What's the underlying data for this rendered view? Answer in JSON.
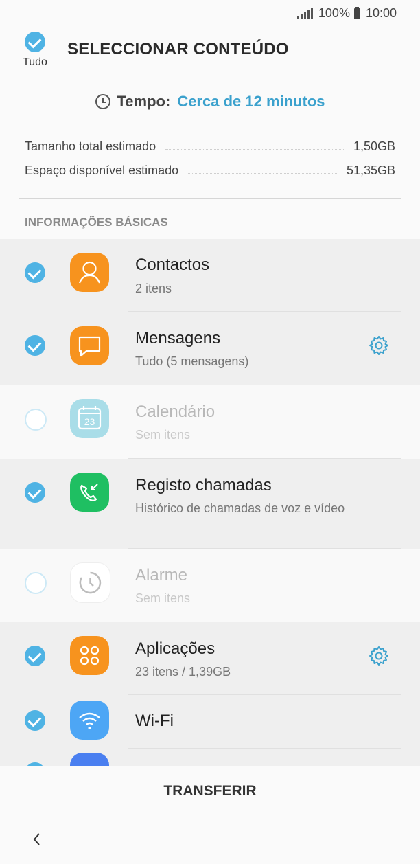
{
  "status": {
    "battery": "100%",
    "time": "10:00"
  },
  "header": {
    "select_all_label": "Tudo",
    "title": "SELECCIONAR CONTEÚDO"
  },
  "estimate": {
    "time_label": "Tempo:",
    "time_value": "Cerca de 12 minutos",
    "total_label": "Tamanho total estimado",
    "total_value": "1,50GB",
    "space_label": "Espaço disponível estimado",
    "space_value": "51,35GB"
  },
  "section": {
    "title": "INFORMAÇÕES BÁSICAS"
  },
  "items": [
    {
      "title": "Contactos",
      "subtitle": "2 itens",
      "checked": true,
      "icon": "contacts-icon",
      "color": "#f7931e"
    },
    {
      "title": "Mensagens",
      "subtitle": "Tudo (5 mensagens)",
      "checked": true,
      "icon": "messages-icon",
      "color": "#f7931e",
      "settings": true
    },
    {
      "title": "Calendário",
      "subtitle": "Sem itens",
      "checked": false,
      "icon": "calendar-icon",
      "color": "#5bc4d9"
    },
    {
      "title": "Registo chamadas",
      "subtitle": "Histórico de chamadas de voz e vídeo",
      "checked": true,
      "icon": "call-log-icon",
      "color": "#1fbf62"
    },
    {
      "title": "Alarme",
      "subtitle": "Sem itens",
      "checked": false,
      "icon": "alarm-icon",
      "color": "#ffffff"
    },
    {
      "title": "Aplicações",
      "subtitle": "23 itens / 1,39GB",
      "checked": true,
      "icon": "apps-icon",
      "color": "#f7931e",
      "settings": true
    },
    {
      "title": "Wi-Fi",
      "subtitle": "",
      "checked": true,
      "icon": "wifi-icon",
      "color": "#4da6f5"
    }
  ],
  "footer": {
    "transfer_label": "TRANSFERIR"
  },
  "colors": {
    "accent": "#4fb3e4",
    "link": "#3ba1cd"
  }
}
